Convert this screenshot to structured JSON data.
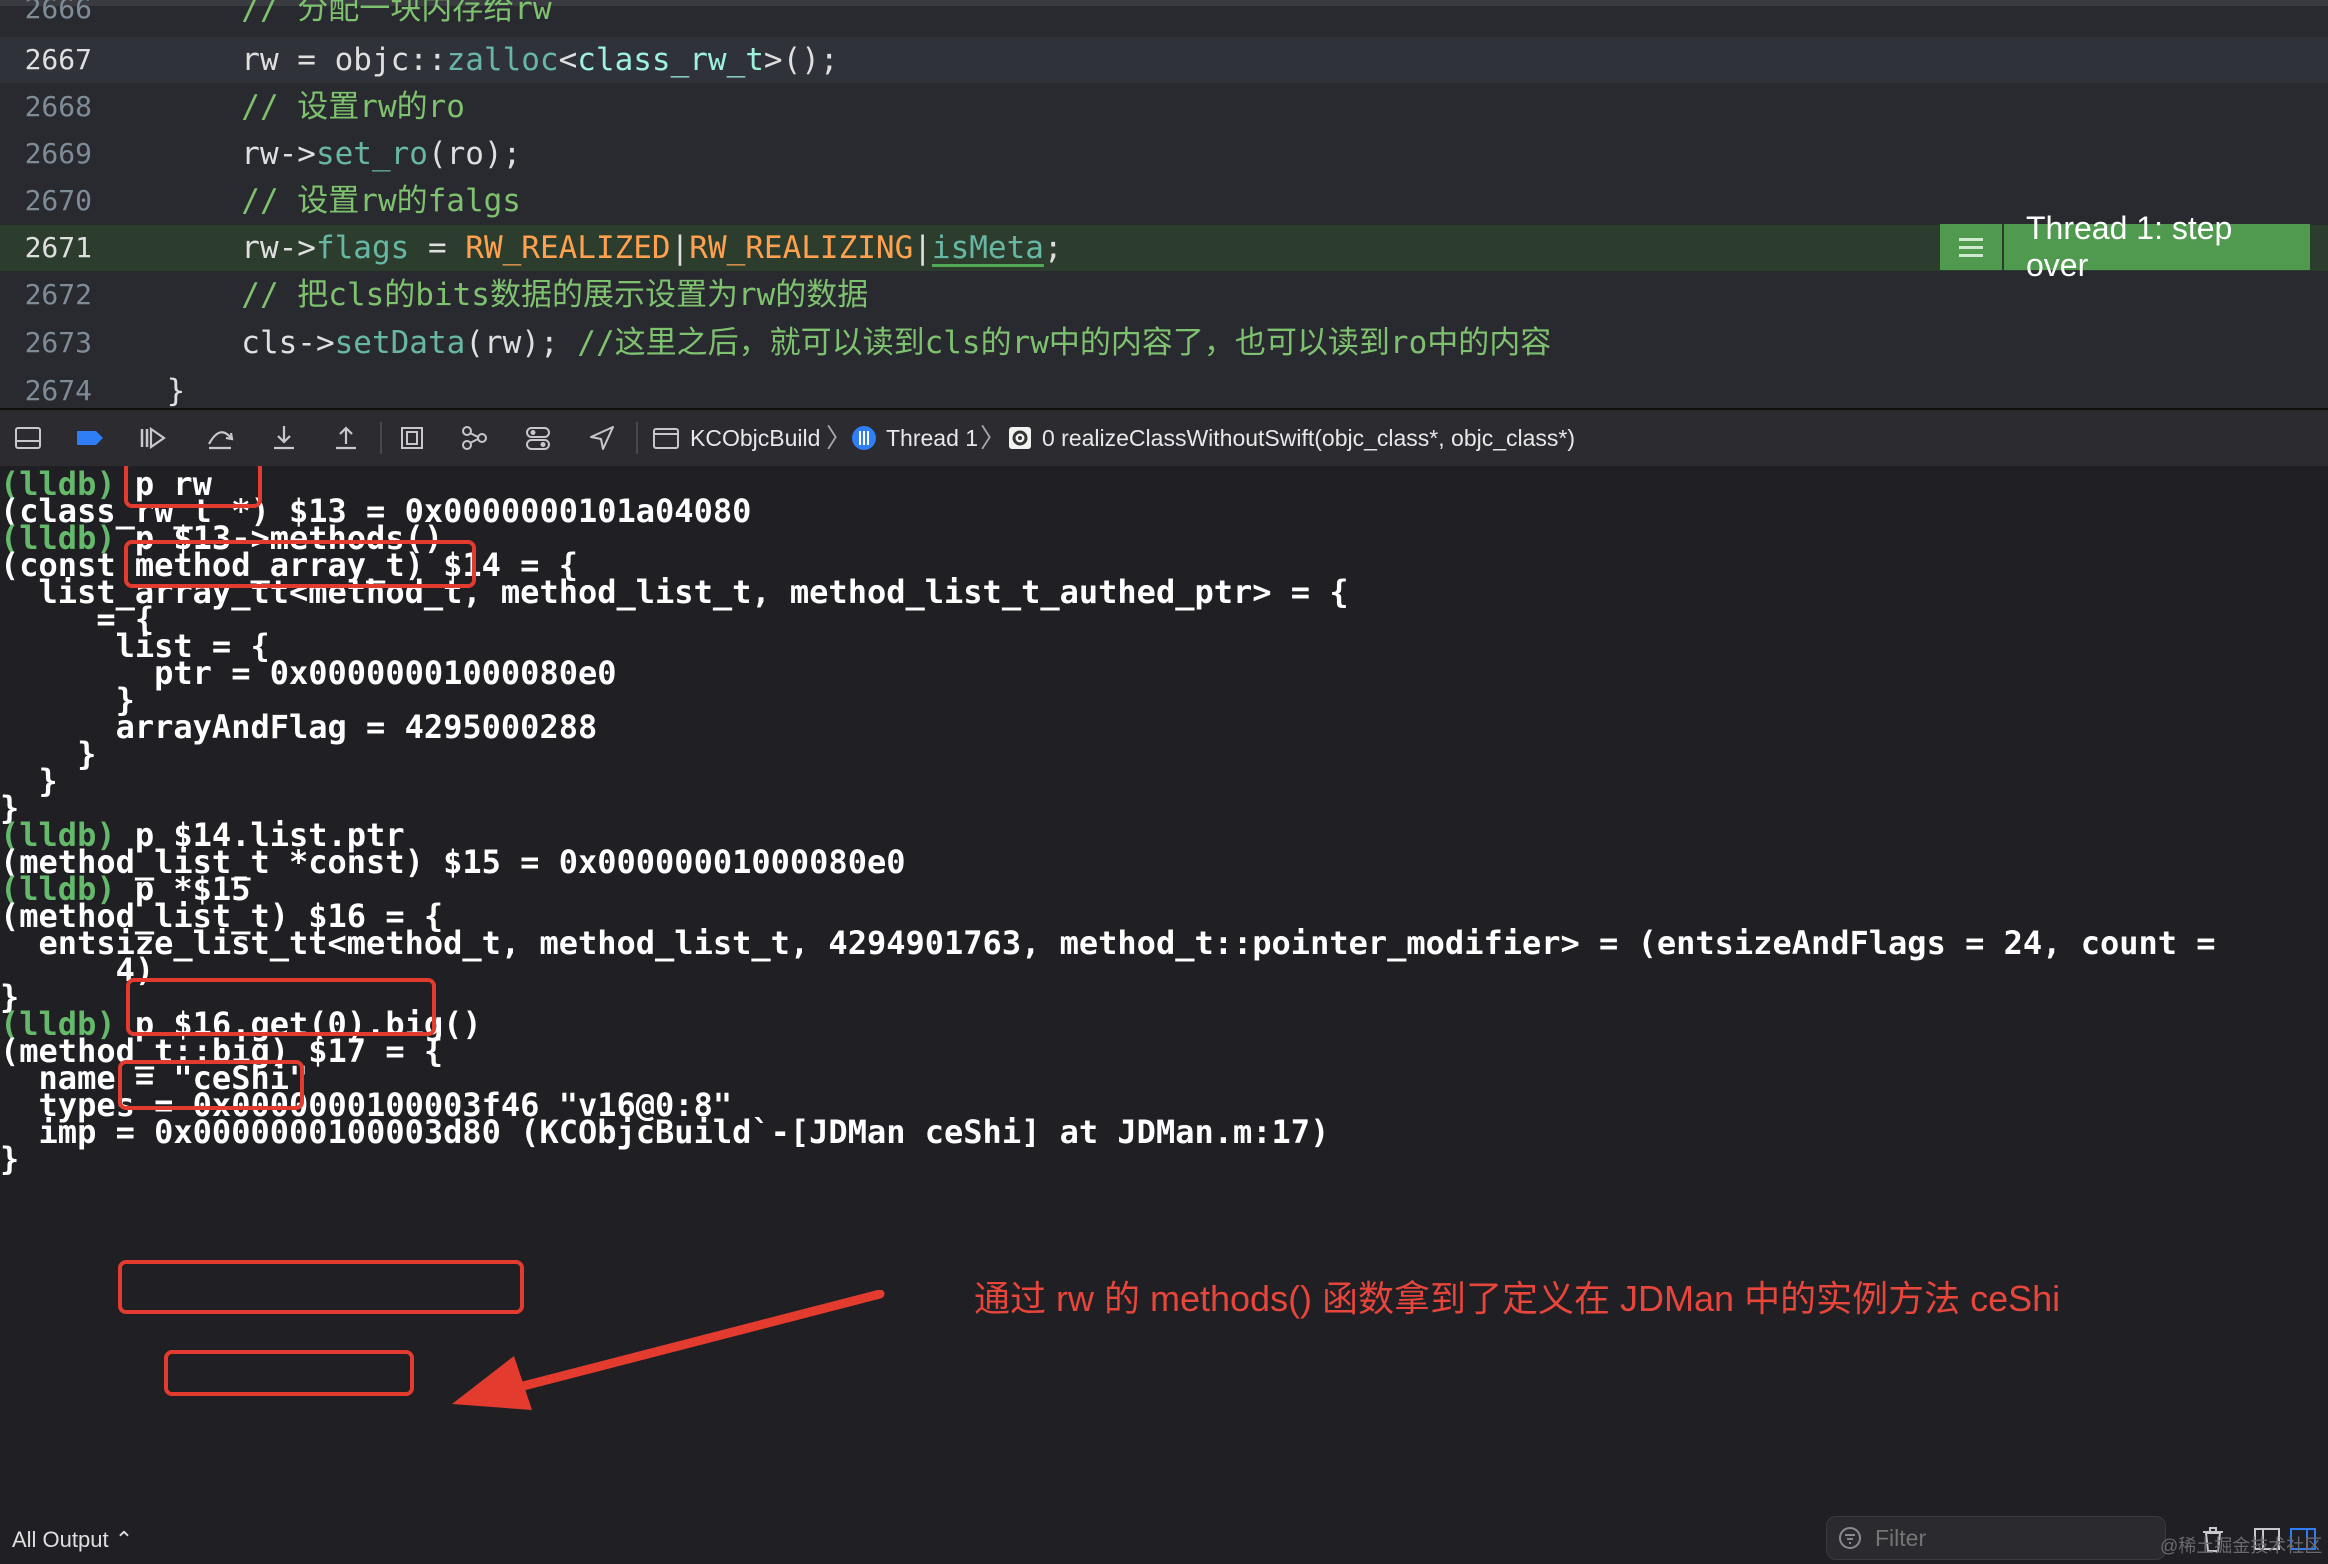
{
  "editor": {
    "lines": [
      {
        "no": "2666",
        "segments": [
          {
            "t": "        // 分配一块内存给rw",
            "c": "comment"
          }
        ]
      },
      {
        "no": "2667",
        "current": true,
        "segments": [
          {
            "t": "        rw = objc::",
            "c": "plain"
          },
          {
            "t": "zalloc",
            "c": "method"
          },
          {
            "t": "<",
            "c": "plain"
          },
          {
            "t": "class_rw_t",
            "c": "type"
          },
          {
            "t": ">();",
            "c": "plain"
          }
        ]
      },
      {
        "no": "2668",
        "segments": [
          {
            "t": "        // 设置rw的ro",
            "c": "comment"
          }
        ]
      },
      {
        "no": "2669",
        "segments": [
          {
            "t": "        rw->",
            "c": "plain"
          },
          {
            "t": "set_ro",
            "c": "method"
          },
          {
            "t": "(ro);",
            "c": "plain"
          }
        ]
      },
      {
        "no": "2670",
        "segments": [
          {
            "t": "        // 设置rw的falgs",
            "c": "comment"
          }
        ]
      },
      {
        "no": "2671",
        "stopped": true,
        "segments": [
          {
            "t": "        rw->",
            "c": "plain"
          },
          {
            "t": "flags",
            "c": "method"
          },
          {
            "t": " = ",
            "c": "plain"
          },
          {
            "t": "RW_REALIZED",
            "c": "macro"
          },
          {
            "t": "|",
            "c": "sep"
          },
          {
            "t": "RW_REALIZING",
            "c": "macro"
          },
          {
            "t": "|",
            "c": "sep"
          },
          {
            "t": "isMeta",
            "c": "underline"
          },
          {
            "t": ";",
            "c": "plain"
          }
        ]
      },
      {
        "no": "2672",
        "segments": [
          {
            "t": "        // 把cls的bits数据的展示设置为rw的数据",
            "c": "comment"
          }
        ]
      },
      {
        "no": "2673",
        "segments": [
          {
            "t": "        cls->",
            "c": "plain"
          },
          {
            "t": "setData",
            "c": "method"
          },
          {
            "t": "(rw); ",
            "c": "plain"
          },
          {
            "t": "//这里之后，就可以读到cls的rw中的内容了，也可以读到ro中的内容",
            "c": "comment"
          }
        ]
      },
      {
        "no": "2674",
        "segments": [
          {
            "t": "    }",
            "c": "plain"
          }
        ]
      }
    ],
    "thread_badge": "Thread 1: step over"
  },
  "debug_bar": {
    "breadcrumb": {
      "target": "KCObjcBuild",
      "thread": "Thread 1",
      "frame": "0 realizeClassWithoutSwift(objc_class*, objc_class*)"
    }
  },
  "console": {
    "lines": [
      {
        "prompt": "(lldb)",
        "text": " p rw"
      },
      {
        "text": "(class_rw_t *) $13 = 0x0000000101a04080"
      },
      {
        "prompt": "(lldb)",
        "text": " p $13->methods()"
      },
      {
        "text": "(const method_array_t) $14 = {"
      },
      {
        "text": "  list_array_tt<method_t, method_list_t, method_list_t_authed_ptr> = {"
      },
      {
        "text": "     = {"
      },
      {
        "text": "      list = {"
      },
      {
        "text": "        ptr = 0x00000001000080e0"
      },
      {
        "text": "      }"
      },
      {
        "text": "      arrayAndFlag = 4295000288"
      },
      {
        "text": "    }"
      },
      {
        "text": "  }"
      },
      {
        "text": "}"
      },
      {
        "prompt": "(lldb)",
        "text": " p $14.list.ptr"
      },
      {
        "text": "(method_list_t *const) $15 = 0x00000001000080e0"
      },
      {
        "prompt": "(lldb)",
        "text": " p *$15"
      },
      {
        "text": "(method_list_t) $16 = {"
      },
      {
        "text": "  entsize_list_tt<method_t, method_list_t, 4294901763, method_t::pointer_modifier> = (entsizeAndFlags = 24, count ="
      },
      {
        "text": "      4)"
      },
      {
        "text": "}"
      },
      {
        "prompt": "(lldb)",
        "text": " p $16.get(0).big()"
      },
      {
        "text": "(method_t::big) $17 = {"
      },
      {
        "text": "  name = \"ceShi\""
      },
      {
        "text": "  types = 0x0000000100003f46 \"v16@0:8\""
      },
      {
        "text": "  imp = 0x0000000100003d80 (KCObjcBuild`-[JDMan ceShi] at JDMan.m:17)"
      },
      {
        "text": "}"
      }
    ],
    "annotation": "通过 rw 的 methods() 函数拿到了定义在 JDMan 中的实例方法 ceShi",
    "annotation_color": "#e8453b"
  },
  "footer": {
    "output_select": "All Output ⌃",
    "filter_placeholder": "Filter",
    "watermark": "@稀土掘金技术社区"
  },
  "colors": {
    "prompt": "#64b96b",
    "highlight_box": "#e33b2e",
    "thread_badge": "#4f9a4f"
  }
}
